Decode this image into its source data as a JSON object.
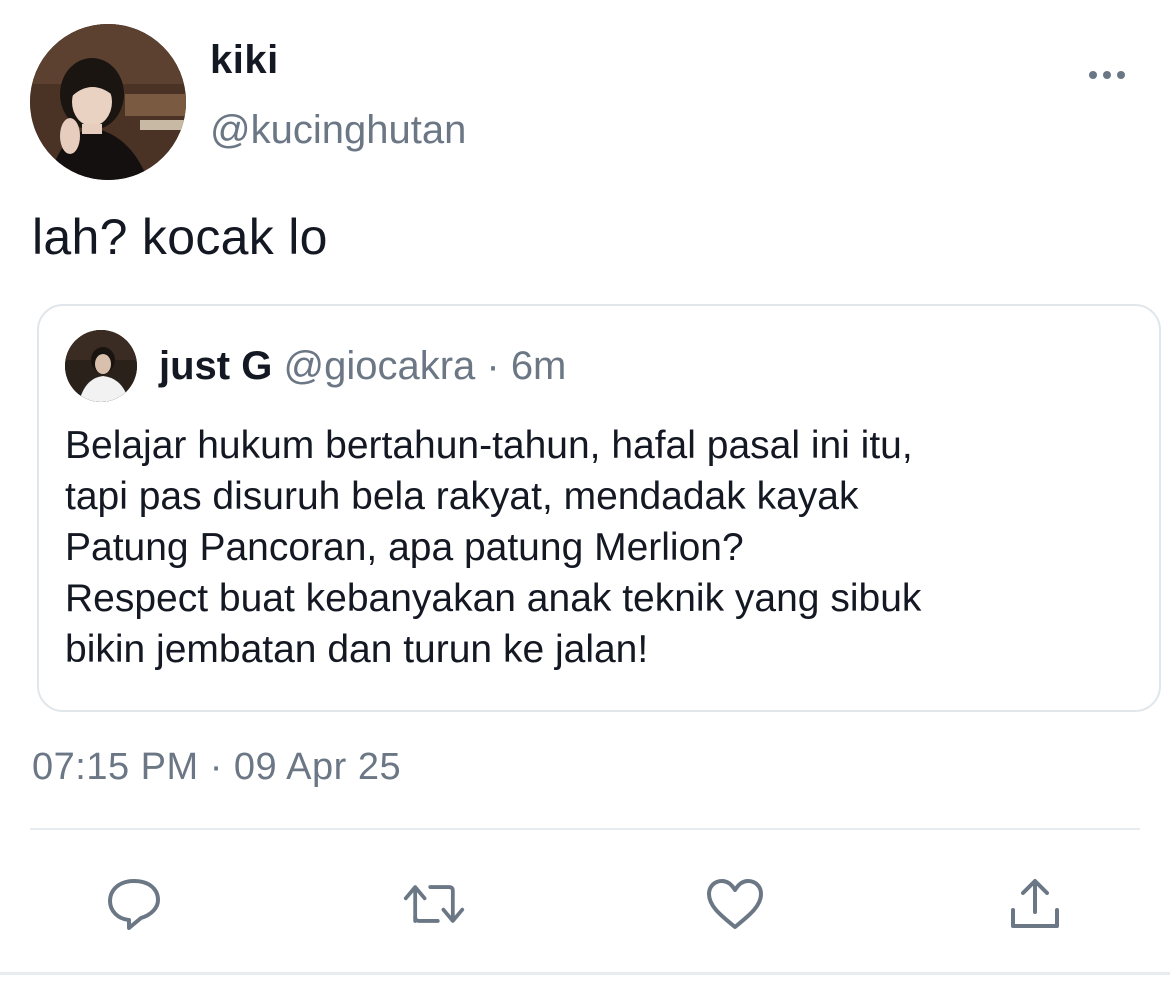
{
  "tweet": {
    "display_name": "kiki",
    "handle": "@kucinghutan",
    "text": "lah? kocak lo",
    "timestamp": "07:15 PM · 09 Apr 25"
  },
  "quote": {
    "display_name": "just G",
    "meta": "@giocakra · 6m",
    "lines": [
      "Belajar hukum bertahun-tahun, hafal pasal ini itu,",
      "tapi pas disuruh bela rakyat, mendadak kayak",
      "Patung Pancoran, apa patung Merlion?",
      "Respect buat kebanyakan anak teknik yang sibuk",
      "bikin jembatan dan turun ke jalan!"
    ]
  },
  "actions": {
    "reply_icon": "speech-bubble",
    "retweet_icon": "retweet-arrows",
    "like_icon": "heart",
    "share_icon": "share-upload"
  },
  "colors": {
    "text": "#141823",
    "muted": "#6b7785",
    "border": "#e1e6ea"
  }
}
